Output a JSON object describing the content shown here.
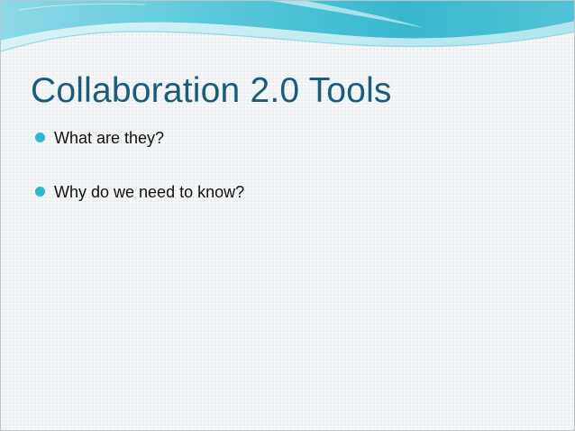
{
  "slide": {
    "title": "Collaboration 2.0 Tools",
    "bullets": [
      {
        "text": "What are they?"
      },
      {
        "text": "Why do we need to know?"
      }
    ]
  },
  "colors": {
    "title": "#1b5d78",
    "bullet": "#2bb8d0",
    "wave_dark": "#4fc3d6",
    "wave_light": "#bfe9f0",
    "background": "#f4f6f8"
  }
}
